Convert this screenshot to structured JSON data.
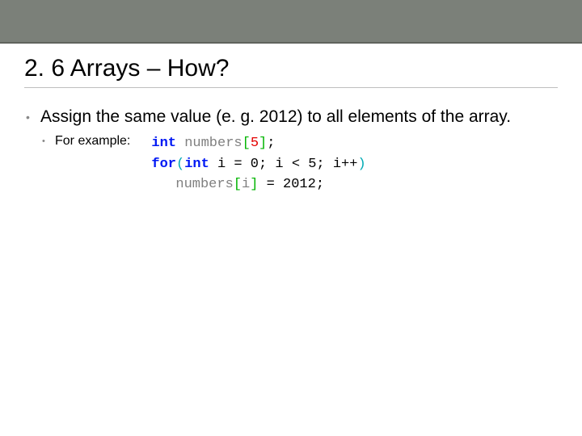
{
  "title": "2. 6 Arrays – How?",
  "bullet1": "Assign the same value (e. g. 2012) to all elements of the array.",
  "bullet2": "For example:",
  "code": {
    "l1": {
      "kw": "int",
      "sp1": " ",
      "id": "numbers",
      "lb": "[",
      "n": "5",
      "rb": "]",
      "semi": ";"
    },
    "l2": "",
    "l3": {
      "kw": "for",
      "lp": "(",
      "kw2": "int",
      "a": " i = 0; i < 5; i++",
      "rp": ")"
    },
    "l4": {
      "id": "numbers",
      "lb": "[",
      "idx": "i",
      "rb": "]",
      "rest": " = 2012;"
    }
  }
}
